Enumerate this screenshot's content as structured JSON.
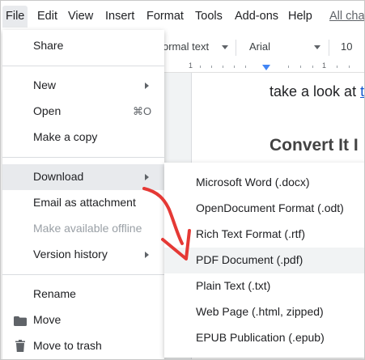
{
  "menubar": {
    "items": [
      "File",
      "Edit",
      "View",
      "Insert",
      "Format",
      "Tools",
      "Add-ons",
      "Help"
    ],
    "all_changes": "All cha"
  },
  "toolbar": {
    "style": "ormal text",
    "font": "Arial",
    "font_size": "10"
  },
  "ruler": {
    "marks": [
      "1",
      "1"
    ]
  },
  "document": {
    "line_text": "take a look at ",
    "link_text": "t",
    "heading": "Convert It I"
  },
  "file_menu": {
    "items": [
      {
        "label": "Share"
      },
      {
        "label": "New"
      },
      {
        "label": "Open",
        "shortcut": "⌘O"
      },
      {
        "label": "Make a copy"
      },
      {
        "label": "Download"
      },
      {
        "label": "Email as attachment"
      },
      {
        "label": "Make available offline"
      },
      {
        "label": "Version history"
      },
      {
        "label": "Rename"
      },
      {
        "label": "Move"
      },
      {
        "label": "Move to trash"
      }
    ]
  },
  "download_menu": {
    "items": [
      {
        "label": "Microsoft Word (.docx)"
      },
      {
        "label": "OpenDocument Format (.odt)"
      },
      {
        "label": "Rich Text Format (.rtf)"
      },
      {
        "label": "PDF Document (.pdf)"
      },
      {
        "label": "Plain Text (.txt)"
      },
      {
        "label": "Web Page (.html, zipped)"
      },
      {
        "label": "EPUB Publication (.epub)"
      }
    ]
  },
  "colors": {
    "annotation_arrow": "#e53935",
    "link": "#1155cc",
    "ruler_marker": "#4285f4"
  }
}
